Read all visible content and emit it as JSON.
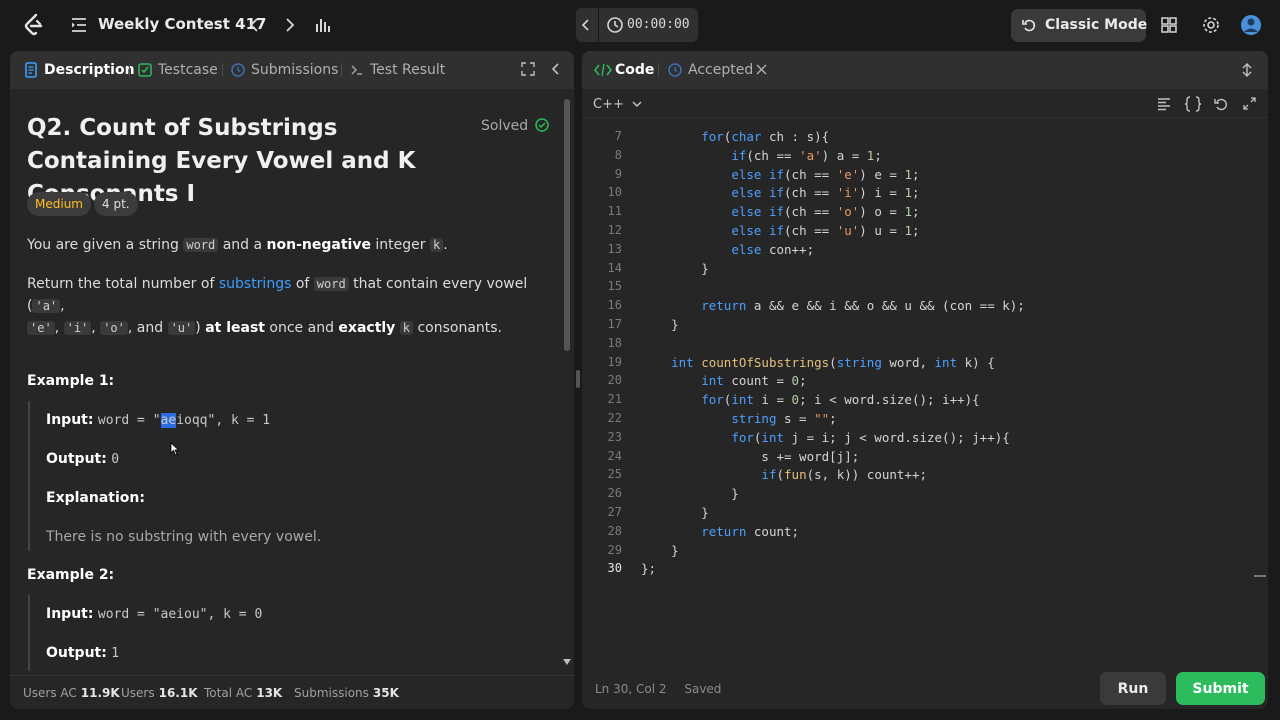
{
  "topbar": {
    "contest_title": "Weekly Contest 417",
    "timer": "00:00:00",
    "mode_label": "Classic Mode"
  },
  "left_tabs": [
    "Description",
    "Testcase",
    "Submissions",
    "Test Result"
  ],
  "problem": {
    "title": "Q2. Count of Substrings Containing Every Vowel and K Consonants I",
    "status": "Solved",
    "difficulty": "Medium",
    "points": "4 pt.",
    "p1": {
      "a": "You are given a string ",
      "code1": "word",
      "b": " and a ",
      "bold1": "non-negative",
      "c": " integer ",
      "code2": "k",
      "d": "."
    },
    "p2": {
      "a": "Return the total number of ",
      "link": "substrings",
      "b": " of ",
      "code1": "word",
      "c": " that contain every vowel (",
      "v1": "'a'",
      "comma1": ",",
      "v2": "'e'",
      "comma2": ",",
      "v3": "'i'",
      "comma3": ",",
      "v4": "'o'",
      "and": ", and",
      "v5": "'u'",
      "d": ")",
      "bold1": "at least",
      "e": " once and ",
      "bold2": "exactly",
      "code2": "k",
      "f": " consonants."
    },
    "example1": {
      "heading": "Example 1:",
      "input_label": "Input:",
      "input_pre": "word = \"",
      "input_hl": "ae",
      "input_post": "ioqq\", k = 1",
      "output_label": "Output:",
      "output_value": "0",
      "explanation_label": "Explanation:",
      "explanation": "There is no substring with every vowel."
    },
    "example2": {
      "heading": "Example 2:",
      "input_label": "Input:",
      "input_value": "word = \"aeiou\", k = 0",
      "output_label": "Output:",
      "output_value": "1"
    }
  },
  "stats": {
    "users_ac_label": "Users AC",
    "users_ac": "11.9K",
    "users_label": "Users",
    "users": "16.1K",
    "total_ac_label": "Total AC",
    "total_ac": "13K",
    "submissions_label": "Submissions",
    "submissions": "35K"
  },
  "right_tabs": {
    "code": "Code",
    "accepted": "Accepted"
  },
  "editor": {
    "language": "C++",
    "line_numbers": [
      "7",
      "8",
      "9",
      "10",
      "11",
      "12",
      "13",
      "14",
      "15",
      "16",
      "17",
      "18",
      "19",
      "20",
      "21",
      "22",
      "23",
      "24",
      "25",
      "26",
      "27",
      "28",
      "29",
      "30"
    ],
    "cursor_status": "Ln 30, Col 2",
    "save_status": "Saved",
    "code_lines": [
      "        for(char ch : s){",
      "            if(ch == 'a') a = 1;",
      "            else if(ch == 'e') e = 1;",
      "            else if(ch == 'i') i = 1;",
      "            else if(ch == 'o') o = 1;",
      "            else if(ch == 'u') u = 1;",
      "            else con++;",
      "        }",
      "",
      "        return a && e && i && o && u && (con == k);",
      "    }",
      "",
      "    int countOfSubstrings(string word, int k) {",
      "        int count = 0;",
      "        for(int i = 0; i < word.size(); i++){",
      "            string s = \"\";",
      "            for(int j = i; j < word.size(); j++){",
      "                s += word[j];",
      "                if(fun(s, k)) count++;",
      "            }",
      "        }",
      "        return count;",
      "    }",
      "};"
    ]
  },
  "buttons": {
    "run": "Run",
    "submit": "Submit"
  },
  "colors": {
    "accent_green": "#2cbb5d",
    "difficulty_medium": "#ffc01e",
    "link_blue": "#3b9cff",
    "keyword_blue": "#4d9fff"
  }
}
